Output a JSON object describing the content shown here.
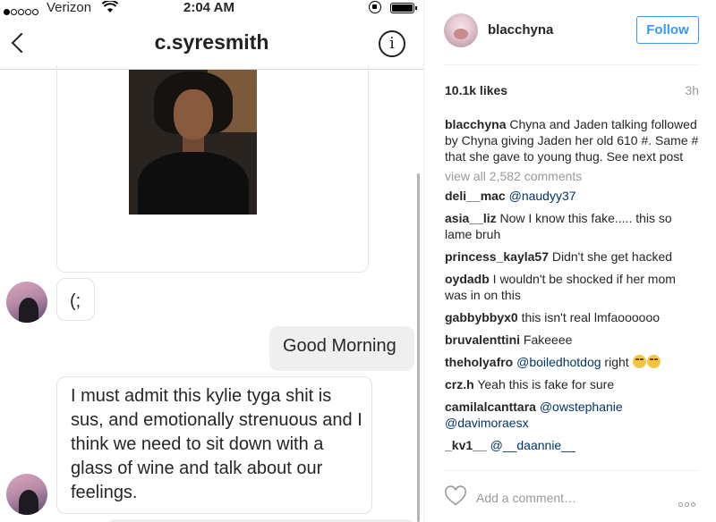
{
  "status_bar": {
    "carrier": "Verizon",
    "time": "2:04 AM"
  },
  "dm": {
    "title": "c.syresmith",
    "messages": [
      {
        "text": "(;"
      },
      {
        "text": "Good Morning"
      },
      {
        "text": "I must admit this kylie tyga shit is sus, and emotionally strenuous and I think we need to sit down with a glass of wine and talk about our feelings."
      }
    ]
  },
  "post": {
    "username": "blacchyna",
    "follow_label": "Follow",
    "likes": "10.1k likes",
    "time_ago": "3h",
    "caption": {
      "user": "blacchyna",
      "text": "Chyna and Jaden talking followed by Chyna giving Jaden her old 610 #. Same # that she gave to young thug. See next post"
    },
    "view_all": "view all 2,582 comments",
    "comments": [
      {
        "user": "deli__mac",
        "mention": "@naudyy37",
        "text": ""
      },
      {
        "user": "asia__liz",
        "mention": "",
        "text": "Now I know this fake..... this so lame bruh"
      },
      {
        "user": "princess_kayla57",
        "mention": "",
        "text": "Didn't she get hacked"
      },
      {
        "user": "oydadb",
        "mention": "",
        "text": "I wouldn't be shocked if her mom was in on this"
      },
      {
        "user": "gabbybbyx0",
        "mention": "",
        "text": "this isn't real lmfaoooooo"
      },
      {
        "user": "bruvalenttini",
        "mention": "",
        "text": "Fakeeee"
      },
      {
        "user": "theholyafro",
        "mention": "@boiledhotdog",
        "text": "right"
      },
      {
        "user": "crz.h",
        "mention": "",
        "text": "Yeah this is fake for sure"
      },
      {
        "user": "camilalcanttara",
        "mention": "@owstephanie @davimoraesx",
        "text": ""
      },
      {
        "user": "_kv1__",
        "mention": "@__daannie__",
        "text": ""
      }
    ],
    "comment_placeholder": "Add a comment…"
  },
  "icons": {
    "back": "chevron-left-icon",
    "info": "info-icon",
    "heart": "heart-icon",
    "more": "more-icon",
    "wifi": "wifi-icon"
  }
}
